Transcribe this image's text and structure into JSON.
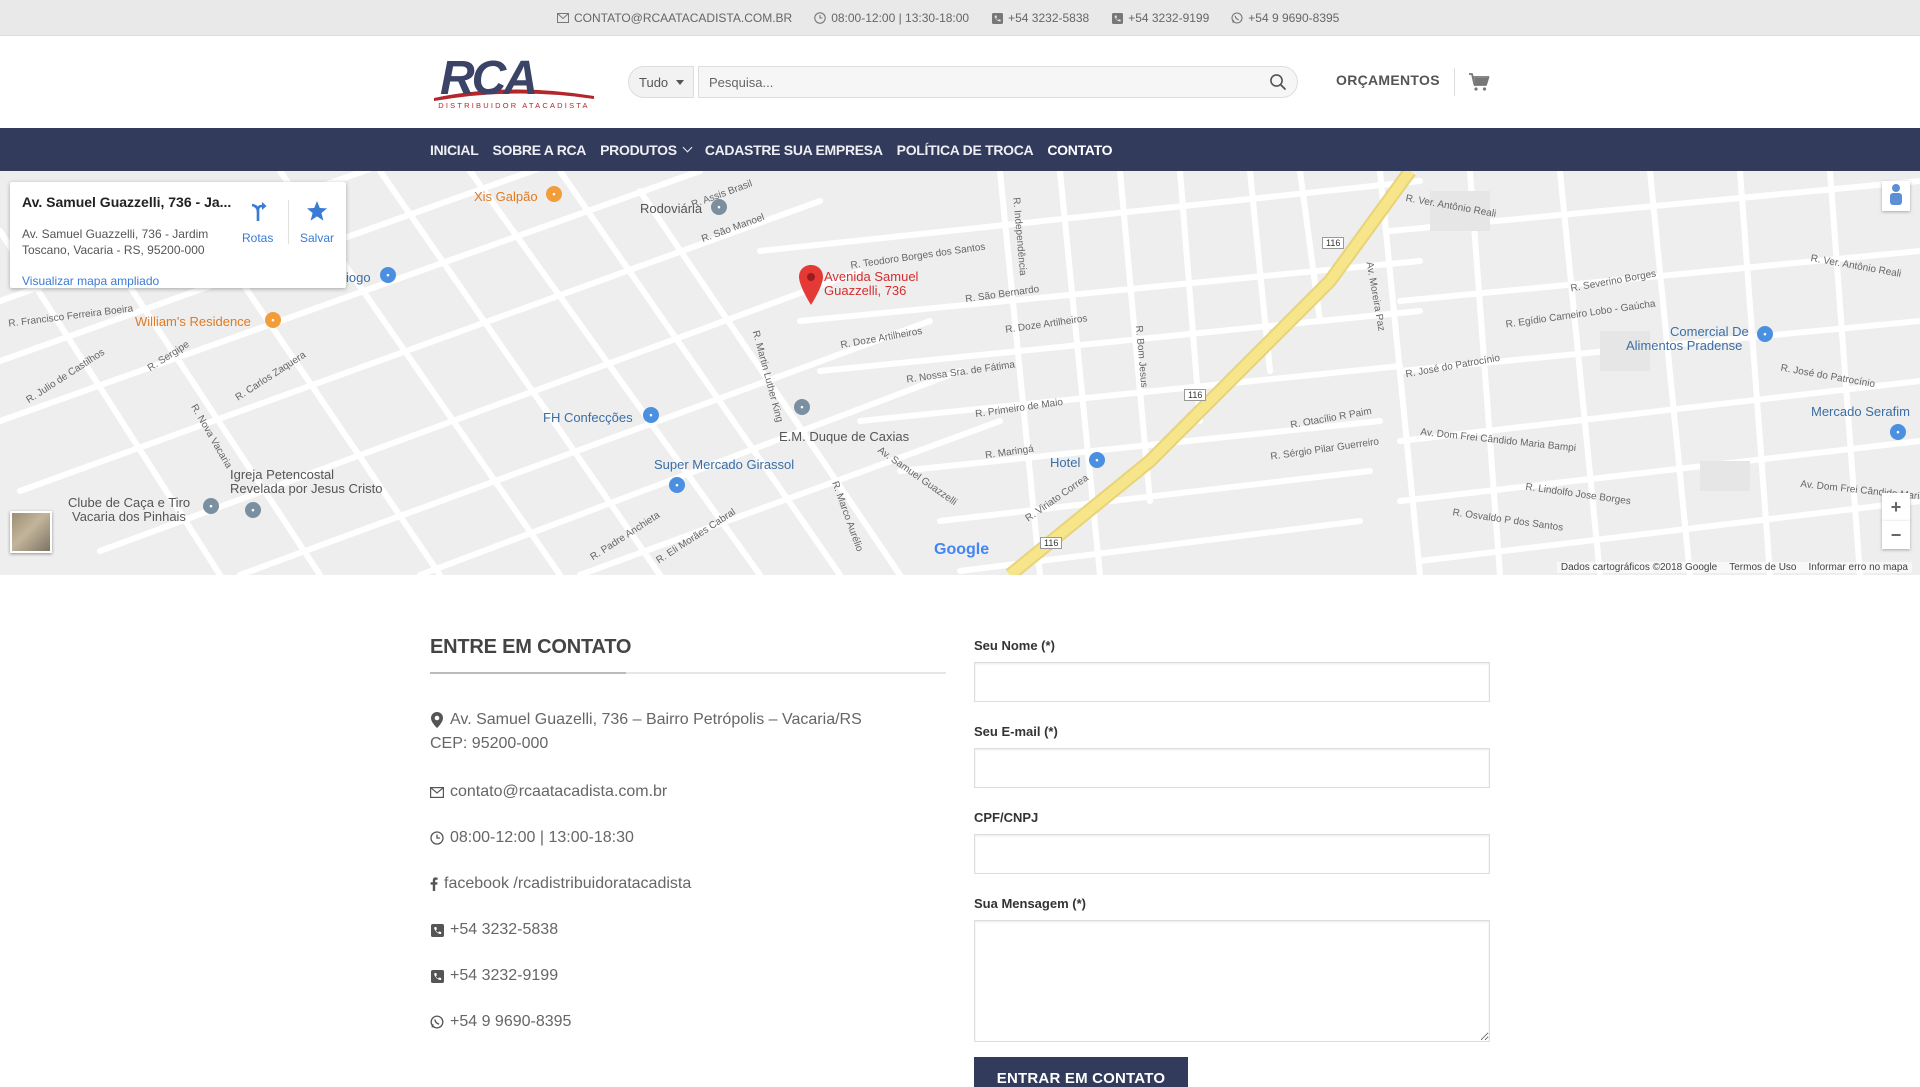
{
  "topbar": {
    "email": "CONTATO@RCAATACADISTA.COM.BR",
    "hours": "08:00-12:00 | 13:30-18:00",
    "phone1": "+54 3232-5838",
    "phone2": "+54 3232-9199",
    "whatsapp": "+54 9 9690-8395",
    "icons": [
      "envelope-icon",
      "clock-icon",
      "phone-icon",
      "phone-icon",
      "whatsapp-icon"
    ]
  },
  "header": {
    "logo_text": "RCA",
    "logo_subtitle": "DISTRIBUIDOR ATACADISTA",
    "category_select": "Tudo",
    "search_placeholder": "Pesquisa...",
    "quotes_link": "ORÇAMENTOS"
  },
  "nav": {
    "items": [
      {
        "label": "INICIAL"
      },
      {
        "label": "SOBRE A RCA"
      },
      {
        "label": "PRODUTOS"
      },
      {
        "label": "CADASTRE SUA EMPRESA"
      },
      {
        "label": "POLÍTICA DE TROCA"
      },
      {
        "label": "CONTATO"
      }
    ]
  },
  "map": {
    "card_title": "Av. Samuel Guazzelli, 736 - Ja...",
    "card_address": "Av. Samuel Guazzelli, 736 - Jardim Toscano, Vacaria - RS, 95200-000",
    "card_link": "Visualizar mapa ampliado",
    "directions_label": "Rotas",
    "save_label": "Salvar",
    "pin_label_1": "Avenida Samuel",
    "pin_label_2": "Guazzelli, 736",
    "google": "Google",
    "footer_data": "Dados cartográficos ©2018 Google",
    "footer_terms": "Termos de Uso",
    "footer_report": "Informar erro no mapa",
    "zoom_in": "+",
    "zoom_out": "−",
    "pois": {
      "xis_galpao": "Xis Galpão",
      "rodoviaria": "Rodoviária",
      "williams": "William's Residence",
      "iogo": "iogo",
      "fh": "FH Confecções",
      "em_duque": "E.M. Duque de Caxias",
      "super_girassol": "Super Mercado Girassol",
      "hotel": "Hotel",
      "igreja_1": "Igreja Petencostal",
      "igreja_2": "Revelada por Jesus Cristo",
      "clube_1": "Clube de Caça e Tiro",
      "clube_2": "Vacaria dos Pinhais",
      "comercial_1": "Comercial De",
      "comercial_2": "Alimentos Pradense",
      "mercado_serafim": "Mercado Serafim"
    },
    "streets": {
      "s1": "R. Assis Brasil",
      "s2": "R. São Manoel",
      "s3": "R. Teodoro Borges dos Santos",
      "s4": "R. São Bernardo",
      "s5": "R. Doze Artilheiros",
      "s6": "R. Nossa Sra. de Fátima",
      "s7": "R. Primeiro de Maio",
      "s8": "R. Maringá",
      "s9": "Av. Samuel Guazzelli",
      "s10": "R. Francisco Ferreira Boeira",
      "s11": "R. Ver. Antônio Reali",
      "s12": "R. Severino Borges",
      "s13": "R. Egídio Carneiro Lobo - Gaúcha",
      "s14": "R. José do Patrocínio",
      "s15": "R. Otacílio R Paim",
      "s16": "R. Sérgio Pilar Guerreiro",
      "s17": "Av. Dom Frei Cândido Maria Bampi",
      "s18": "R. Lindolfo Jose Borges",
      "s19": "R. Osvaldo P dos Santos",
      "s20": "R. Viriato Correa",
      "s21": "R. Padre Anchieta",
      "s22": "R. Eli Morães Cabral",
      "s23": "R. Carlos Zaquera",
      "s24": "R. Sergipe",
      "s25": "R. Julio de Castilhos",
      "s26": "R. Nova Vacaria",
      "s27": "R. Martin Luther King",
      "s28": "R. Marco Aurélio",
      "s29": "Av. Moreira Paz",
      "s30": "R. Independência",
      "s31": "R. Bom Jesus",
      "hw": "116"
    }
  },
  "contact": {
    "title": "ENTRE EM CONTATO",
    "address_line1": "Av. Samuel Guazelli, 736 – Bairro Petrópolis – Vacaria/RS",
    "address_line2": "CEP: 95200-000",
    "email": "contato@rcaatacadista.com.br",
    "hours": "08:00-12:00 | 13:00-18:30",
    "facebook": "facebook /rcadistribuidoratacadista",
    "phone1": "+54 3232-5838",
    "phone2": "+54 3232-9199",
    "whatsapp": "+54 9 9690-8395"
  },
  "form": {
    "name_label": "Seu Nome (*)",
    "email_label": "Seu E-mail (*)",
    "doc_label": "CPF/CNPJ",
    "message_label": "Sua Mensagem (*)",
    "submit_label": "ENTRAR EM CONTATO"
  },
  "colors": {
    "nav_bg": "#323b5c",
    "topbar_bg": "#e9e9e9",
    "map_pin": "#e53935",
    "highway": "#f7e58a"
  }
}
